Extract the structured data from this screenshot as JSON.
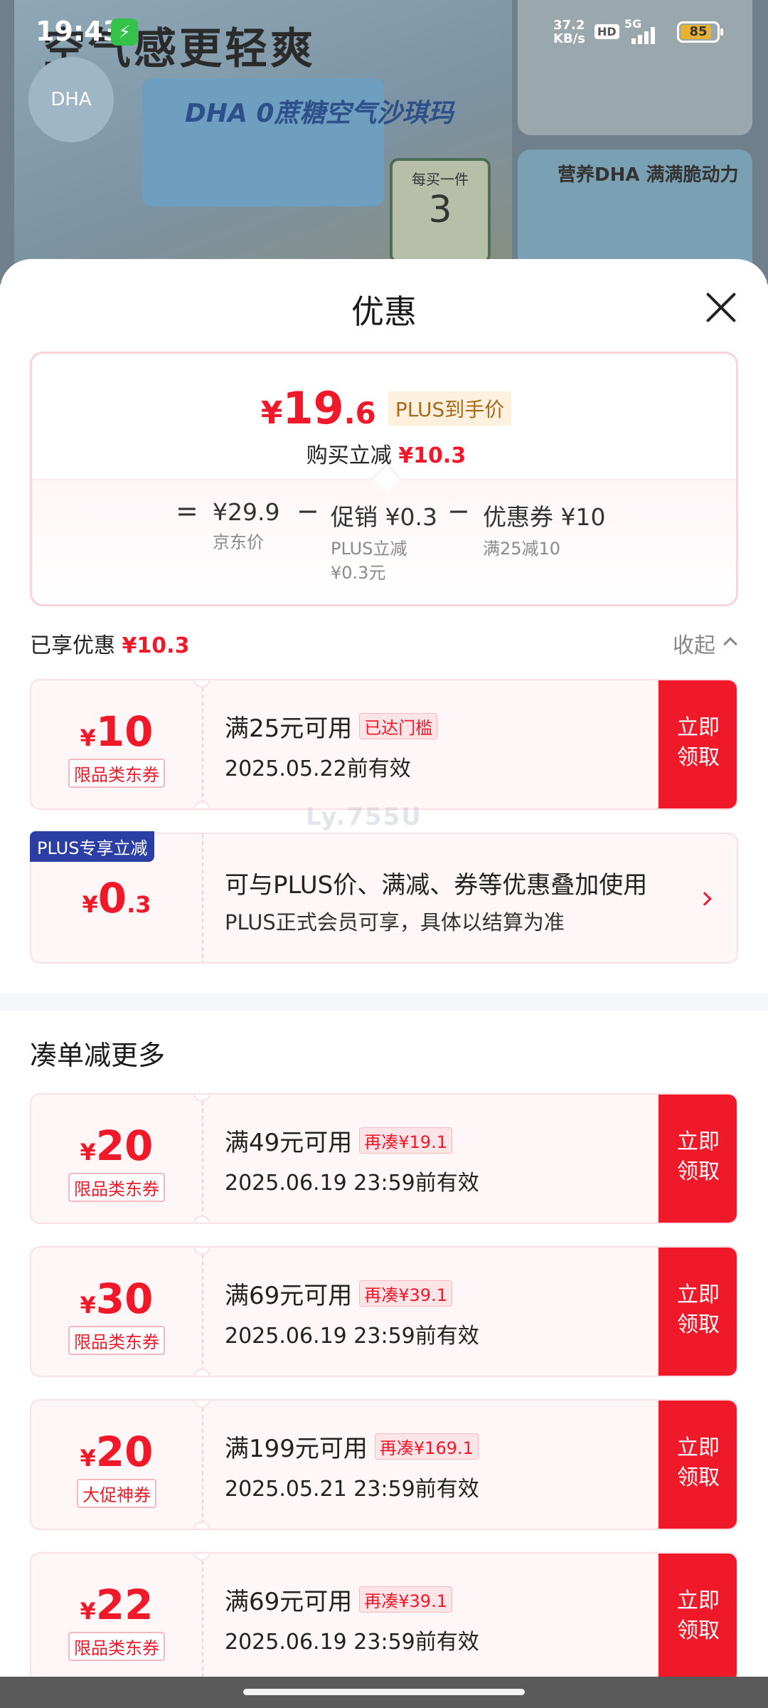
{
  "status_bar": {
    "time": "19:43",
    "net_speed_value": "37.2",
    "net_speed_unit": "KB/s",
    "hd": "HD",
    "network": "5G",
    "battery": "85"
  },
  "background": {
    "headline": "空气感更轻爽",
    "product_text": "DHA 0蔗糖空气沙琪玛",
    "dha_badge": "DHA",
    "right_card_title": "营养DHA 满满脆动力",
    "rebate_badge_top": "每买一件",
    "rebate_badge_amount": "3"
  },
  "sheet": {
    "title": "优惠",
    "summary": {
      "currency": "¥",
      "price_int": "19",
      "price_dec": ".6",
      "plus_tag": "PLUS到手价",
      "instant_label": "购买立减",
      "instant_amount": "¥10.3",
      "formula": {
        "eq": "=",
        "jd_price": "¥29.9",
        "jd_price_label": "京东价",
        "minus1": "−",
        "promo": "促销 ¥0.3",
        "promo_sub1": "PLUS立减",
        "promo_sub2": "¥0.3元",
        "minus2": "−",
        "coupon": "优惠券 ¥10",
        "coupon_sub": "满25减10"
      }
    },
    "enjoyed_label": "已享优惠",
    "enjoyed_amount": "¥10.3",
    "collapse_label": "收起",
    "enjoyed_coupons": [
      {
        "currency": "¥",
        "amount": "10",
        "type": "限品类东券",
        "condition": "满25元可用",
        "chip": "已达门槛",
        "valid": "2025.05.22前有效",
        "claim_line1": "立即",
        "claim_line2": "领取"
      }
    ],
    "plus_card": {
      "badge": "PLUS专享立减",
      "currency": "¥",
      "amount_int": "0",
      "amount_dec": ".3",
      "desc_main": "可与PLUS价、满减、券等优惠叠加使用",
      "desc_sub": "PLUS正式会员可享，具体以结算为准"
    },
    "watermark": "Ly.755U",
    "more_section_title": "凑单减更多",
    "more_coupons": [
      {
        "currency": "¥",
        "amount": "20",
        "type": "限品类东券",
        "condition": "满49元可用",
        "chip": "再凑¥19.1",
        "valid": "2025.06.19 23:59前有效",
        "claim_line1": "立即",
        "claim_line2": "领取"
      },
      {
        "currency": "¥",
        "amount": "30",
        "type": "限品类东券",
        "condition": "满69元可用",
        "chip": "再凑¥39.1",
        "valid": "2025.06.19 23:59前有效",
        "claim_line1": "立即",
        "claim_line2": "领取"
      },
      {
        "currency": "¥",
        "amount": "20",
        "type": "大促神券",
        "condition": "满199元可用",
        "chip": "再凑¥169.1",
        "valid": "2025.05.21 23:59前有效",
        "claim_line1": "立即",
        "claim_line2": "领取"
      },
      {
        "currency": "¥",
        "amount": "22",
        "type": "限品类东券",
        "condition": "满69元可用",
        "chip": "再凑¥39.1",
        "valid": "2025.06.19 23:59前有效",
        "claim_line1": "立即",
        "claim_line2": "领取"
      }
    ]
  },
  "colors": {
    "accent_red": "#f0192a",
    "plus_blue": "#2b3ea3",
    "plus_gold": "#a96a1c"
  }
}
